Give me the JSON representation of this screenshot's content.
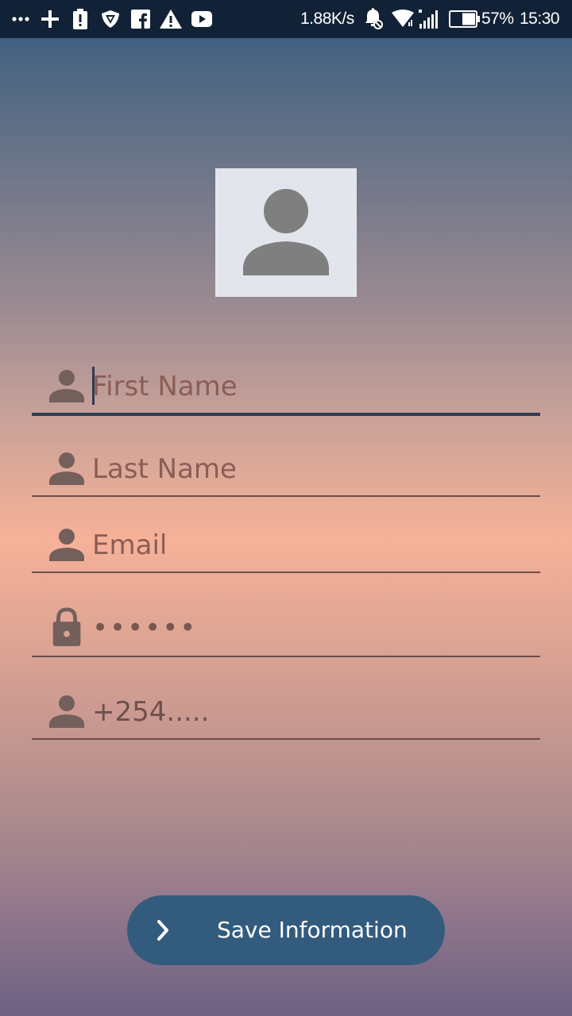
{
  "status_bar": {
    "icons_left": [
      "more-dots-icon",
      "plus-icon",
      "battery-alert-icon",
      "shield-app-icon",
      "facebook-icon",
      "warning-icon",
      "youtube-icon"
    ],
    "icons_right": [
      "bell-muted-icon",
      "wifi-icon",
      "cell-signal-icon",
      "battery-icon"
    ],
    "speed": "1.88K/s",
    "battery_percent": "57%",
    "time": "15:30"
  },
  "profile": {
    "avatar_icon": "person-placeholder-icon"
  },
  "form": {
    "first_name": {
      "icon": "person-icon",
      "placeholder": "First Name",
      "value": ""
    },
    "last_name": {
      "icon": "person-icon",
      "placeholder": "Last Name",
      "value": ""
    },
    "email": {
      "icon": "person-icon",
      "placeholder": "Email",
      "value": ""
    },
    "password": {
      "icon": "lock-icon",
      "value": "••••••"
    },
    "phone": {
      "icon": "person-icon",
      "placeholder": "+254.....",
      "value": ""
    }
  },
  "save_button": {
    "icon": "chevron-right-icon",
    "label": "Save Information"
  },
  "colors": {
    "status_bar_bg": "#122236",
    "button_bg": "#335b7e",
    "icon_color": "#735f5b",
    "focused_underline": "#2e3b55"
  }
}
